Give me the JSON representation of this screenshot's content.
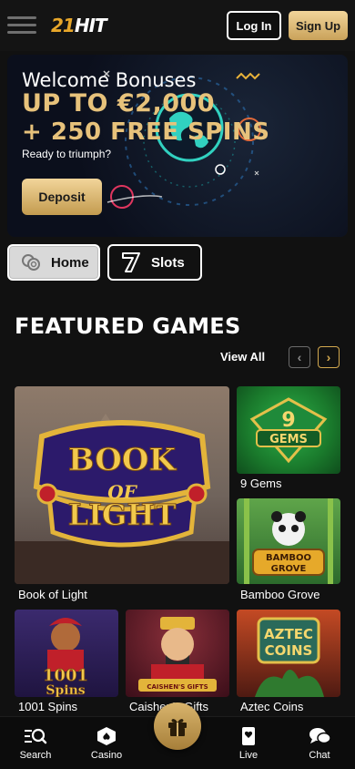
{
  "header": {
    "logo_num": "21",
    "logo_text": "HIT",
    "login_label": "Log In",
    "signup_label": "Sign Up",
    "menu_icon": "hamburger-menu-icon"
  },
  "banner": {
    "line1": "Welcome Bonuses",
    "line2": "UP TO €2,000",
    "line3": "+ 250 FREE SPINS",
    "subtitle": "Ready to triumph?",
    "deposit_label": "Deposit",
    "accent": "#e7c27b"
  },
  "nav_tabs": [
    {
      "label": "Home",
      "icon": "chips-icon",
      "active": true
    },
    {
      "label": "Slots",
      "icon": "seven-icon",
      "active": false
    }
  ],
  "featured": {
    "title": "FEATURED GAMES",
    "view_all": "View All",
    "games": [
      {
        "name": "Book of Light",
        "art": "BOOK OF LIGHT"
      },
      {
        "name": "9 Gems",
        "art": "9 GEMS"
      },
      {
        "name": "Bamboo Grove",
        "art": "BAMBOO GROVE"
      },
      {
        "name": "1001 Spins",
        "art": "1001 Spins"
      },
      {
        "name": "Caishen's Gifts",
        "art": "CAISHEN'S GIFTS"
      },
      {
        "name": "Aztec Coins",
        "art": "AZTEC COINS"
      }
    ]
  },
  "bottom_nav": {
    "search": "Search",
    "casino": "Casino",
    "live": "Live",
    "chat": "Chat",
    "center_icon": "gift-icon"
  },
  "colors": {
    "gold": "#d3a94f",
    "background": "#111111"
  }
}
